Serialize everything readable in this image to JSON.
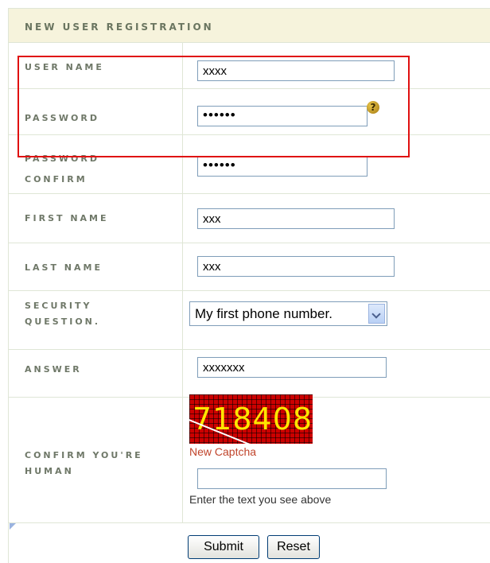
{
  "header": {
    "title": "NEW USER REGISTRATION"
  },
  "fields": {
    "username": {
      "label": "USER NAME",
      "value": "xxxx"
    },
    "password": {
      "label": "PASSWORD",
      "value": "••••••",
      "help_icon": "question-icon"
    },
    "password_confirm": {
      "label_line1": "PASSWORD",
      "label_line2": "CONFIRM",
      "value": "••••••"
    },
    "first_name": {
      "label": "FIRST NAME",
      "value": "xxx"
    },
    "last_name": {
      "label": "LAST NAME",
      "value": "xxx"
    },
    "security_question": {
      "label_line1": "SECURITY",
      "label_line2": "QUESTION.",
      "selected": "My first phone number."
    },
    "answer": {
      "label": "ANSWER",
      "value": "xxxxxxx"
    },
    "captcha": {
      "label_line1": "CONFIRM YOU'RE",
      "label_line2": "HUMAN",
      "image_text": "718408",
      "new_captcha_link": "New Captcha",
      "input_value": "",
      "hint": "Enter the text you see above"
    }
  },
  "buttons": {
    "submit": "Submit",
    "reset": "Reset"
  },
  "colors": {
    "highlight": "#e01010",
    "header_bg": "#f6f3dc",
    "link": "#c0442b"
  }
}
